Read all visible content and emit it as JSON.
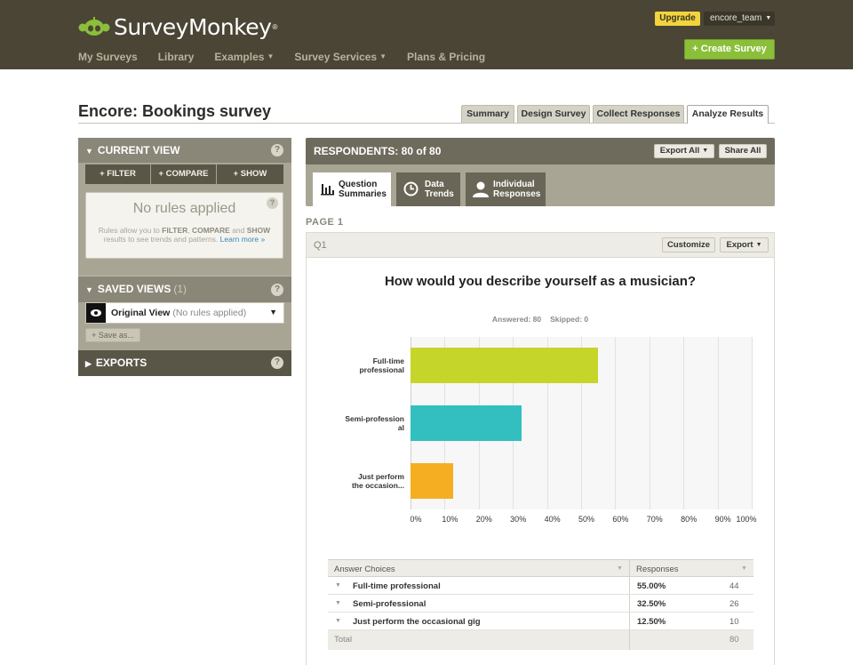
{
  "header": {
    "logo_text": "SurveyMonkey",
    "logo_reg": "®",
    "nav": [
      {
        "label": "My Surveys",
        "caret": ""
      },
      {
        "label": "Library",
        "caret": ""
      },
      {
        "label": "Examples",
        "caret": "▼"
      },
      {
        "label": "Survey Services",
        "caret": "▼"
      },
      {
        "label": "Plans & Pricing",
        "caret": ""
      }
    ],
    "upgrade_label": "Upgrade",
    "username": "encore_team",
    "create_label": "+ Create Survey",
    "colors": {
      "bar": "#4a4535",
      "create": "#8bbf3a",
      "upgrade": "#f2d43d"
    }
  },
  "page": {
    "survey_title": "Encore: Bookings survey",
    "tabs": [
      {
        "label": "Summary",
        "active": false
      },
      {
        "label": "Design Survey",
        "active": false
      },
      {
        "label": "Collect Responses",
        "active": false
      },
      {
        "label": "Analyze Results",
        "active": true
      }
    ]
  },
  "sidebar": {
    "current_view": {
      "title": "CURRENT VIEW",
      "arrow": "▼",
      "help": "?",
      "buttons": [
        "+ FILTER",
        "+ COMPARE",
        "+ SHOW"
      ],
      "rules_title": "No rules applied",
      "rules_help": "?",
      "desc_1": "Rules allow you to ",
      "desc_filter": "FILTER",
      "desc_2": ", ",
      "desc_compare": "COMPARE",
      "desc_3": " and ",
      "desc_show": "SHOW",
      "desc_4": " results to see trends and patterns. ",
      "learn_more": "Learn more »"
    },
    "saved_views": {
      "title": "SAVED VIEWS",
      "count": "(1)",
      "arrow": "▼",
      "help": "?",
      "view_name": "Original View",
      "view_sub": "(No rules applied)",
      "view_caret": "▼",
      "save_as": "+ Save as..."
    },
    "exports": {
      "title": "EXPORTS",
      "arrow": "▶",
      "help": "?"
    }
  },
  "main": {
    "respondents": "RESPONDENTS: 80 of 80",
    "export_all": "Export All",
    "share_all": "Share All",
    "caret": "▼",
    "view_tabs": [
      {
        "line1": "Question",
        "line2": "Summaries",
        "icon": "bar-chart-icon",
        "active": true
      },
      {
        "line1": "Data",
        "line2": "Trends",
        "icon": "clock-icon",
        "active": false
      },
      {
        "line1": "Individual",
        "line2": "Responses",
        "icon": "person-icon",
        "active": false
      }
    ],
    "page_label": "PAGE 1",
    "question": {
      "number": "Q1",
      "customize": "Customize",
      "export": "Export",
      "title": "How would you describe yourself as a musician?",
      "answered": "Answered: 80",
      "skipped": "Skipped: 0"
    }
  },
  "chart_data": {
    "type": "bar",
    "orientation": "horizontal",
    "categories": [
      "Full-time professional",
      "Semi-professional",
      "Just perform the occasional gig"
    ],
    "category_tick_labels": [
      [
        "Full-time",
        "professional"
      ],
      [
        "Semi-profession",
        "al"
      ],
      [
        "Just perform",
        "the occasion..."
      ]
    ],
    "values": [
      55.0,
      32.5,
      12.5
    ],
    "colors": [
      "#c6d52a",
      "#33bfc0",
      "#f5ae21"
    ],
    "xlim": [
      0,
      100
    ],
    "xticks": [
      "0%",
      "10%",
      "20%",
      "30%",
      "40%",
      "50%",
      "60%",
      "70%",
      "80%",
      "90%",
      "100%"
    ],
    "grid": true
  },
  "table": {
    "col_answer": "Answer Choices",
    "col_responses": "Responses",
    "rows": [
      {
        "choice": "Full-time professional",
        "pct": "55.00%",
        "count": "44"
      },
      {
        "choice": "Semi-professional",
        "pct": "32.50%",
        "count": "26"
      },
      {
        "choice": "Just perform the occasional gig",
        "pct": "12.50%",
        "count": "10"
      }
    ],
    "total_label": "Total",
    "total_count": "80"
  }
}
